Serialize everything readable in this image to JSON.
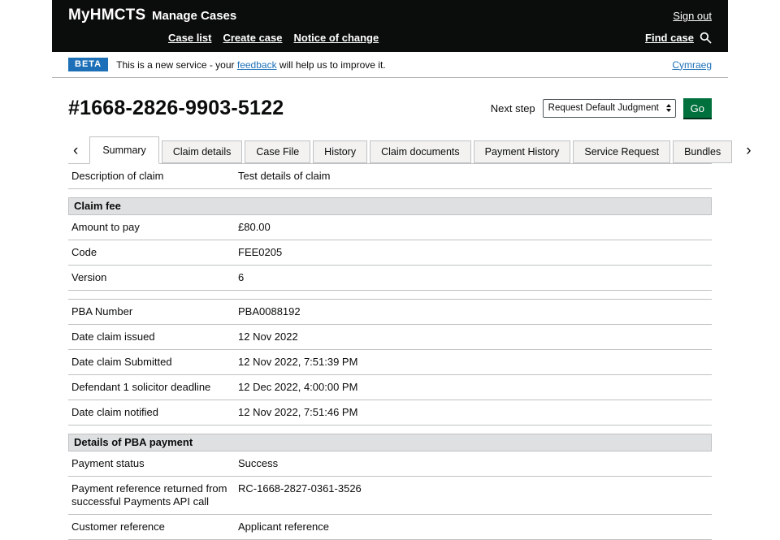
{
  "colors": {
    "header_bg": "#0b0c0c",
    "beta_badge_bg": "#1d70b8",
    "link_blue": "#1d70b8",
    "go_button_bg": "#00703c",
    "section_header_bg": "#dee0e2",
    "tab_bg": "#f3f2f1",
    "border_grey": "#bfc1c3"
  },
  "header": {
    "brand": "MyHMCTS",
    "app_title": "Manage Cases",
    "sign_out": "Sign out",
    "nav": [
      "Case list",
      "Create case",
      "Notice of change"
    ],
    "find_case": "Find case"
  },
  "beta_bar": {
    "badge": "BETA",
    "text_before": "This is a new service - your ",
    "feedback_link": "feedback",
    "text_after": " will help us to improve it.",
    "language_link": "Cymraeg"
  },
  "case_header": {
    "case_number": "#1668-2826-9903-5122",
    "next_step_label": "Next step",
    "next_step_value": "Request Default Judgment",
    "go_button": "Go"
  },
  "icons": {
    "chevron_left": "‹",
    "chevron_right": "›",
    "search": "magnifier"
  },
  "tabs": [
    "Summary",
    "Claim details",
    "Case File",
    "History",
    "Claim documents",
    "Payment History",
    "Service Request",
    "Bundles"
  ],
  "active_tab": "Summary",
  "details": {
    "groups": [
      {
        "rows": [
          {
            "label": "Description of claim",
            "value": "Test details of claim"
          }
        ]
      },
      {
        "header": "Claim fee",
        "rows": [
          {
            "label": "Amount to pay",
            "value": "£80.00"
          },
          {
            "label": "Code",
            "value": "FEE0205"
          },
          {
            "label": "Version",
            "value": "6"
          }
        ]
      },
      {
        "rows": [
          {
            "label": "PBA Number",
            "value": "PBA0088192"
          },
          {
            "label": "Date claim issued",
            "value": "12 Nov 2022"
          },
          {
            "label": "Date claim Submitted",
            "value": "12 Nov 2022, 7:51:39 PM"
          },
          {
            "label": "Defendant 1 solicitor deadline",
            "value": "12 Dec 2022, 4:00:00 PM"
          },
          {
            "label": "Date claim notified",
            "value": "12 Nov 2022, 7:51:46 PM"
          }
        ]
      },
      {
        "header": "Details of PBA payment",
        "rows": [
          {
            "label": "Payment status",
            "value": "Success"
          },
          {
            "label": "Payment reference returned from successful Payments API call",
            "value": "RC-1668-2827-0361-3526"
          },
          {
            "label": "Customer reference",
            "value": "Applicant reference"
          }
        ]
      }
    ]
  }
}
